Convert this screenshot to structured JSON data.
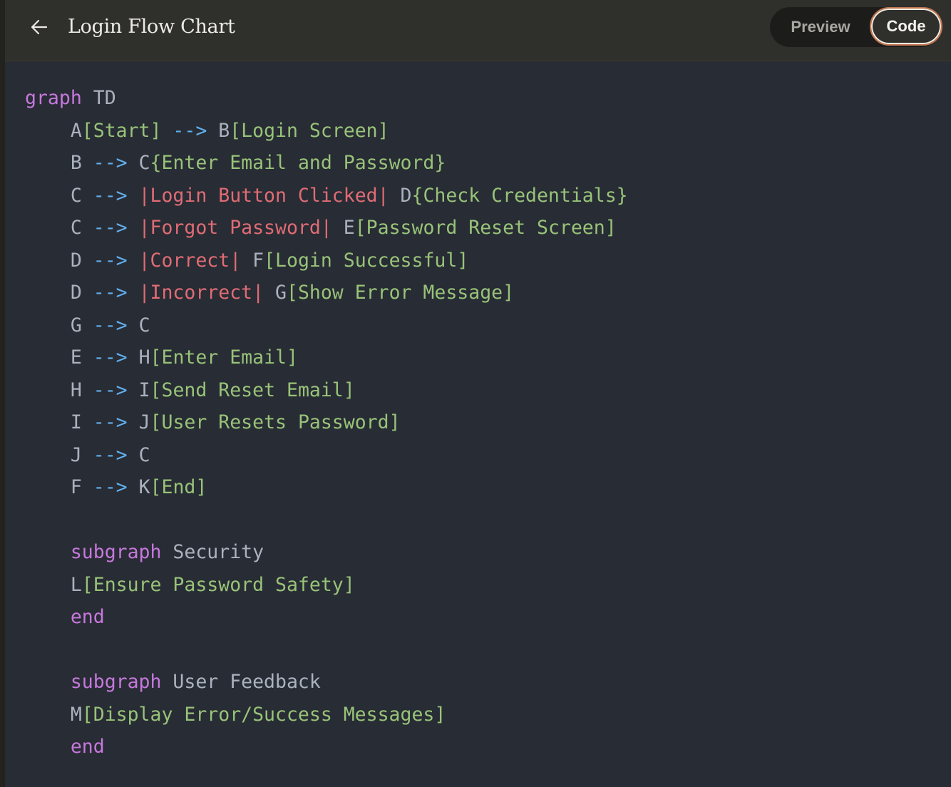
{
  "header": {
    "back_icon": "arrow-left-icon",
    "title": "Login Flow Chart",
    "toggle": {
      "preview_label": "Preview",
      "code_label": "Code",
      "active": "Code"
    }
  },
  "colors": {
    "keyword": "#c678dd",
    "identifier": "#abb2bf",
    "arrow": "#61afef",
    "node_text": "#98c379",
    "edge_label": "#e06c75",
    "code_background": "#282c34",
    "active_toggle_border": "#c27552"
  },
  "code": {
    "lines": [
      [
        {
          "t": "graph",
          "c": "kw"
        },
        {
          "t": " TD",
          "c": "plain"
        }
      ],
      [
        {
          "t": "    A",
          "c": "id"
        },
        {
          "t": "[Start]",
          "c": "node"
        },
        {
          "t": " --> ",
          "c": "arrow"
        },
        {
          "t": "B",
          "c": "id"
        },
        {
          "t": "[Login Screen]",
          "c": "node"
        }
      ],
      [
        {
          "t": "    B",
          "c": "id"
        },
        {
          "t": " --> ",
          "c": "arrow"
        },
        {
          "t": "C",
          "c": "id"
        },
        {
          "t": "{Enter Email and Password}",
          "c": "node"
        }
      ],
      [
        {
          "t": "    C",
          "c": "id"
        },
        {
          "t": " --> ",
          "c": "arrow"
        },
        {
          "t": "|Login Button Clicked|",
          "c": "edge"
        },
        {
          "t": " D",
          "c": "id"
        },
        {
          "t": "{Check Credentials}",
          "c": "node"
        }
      ],
      [
        {
          "t": "    C",
          "c": "id"
        },
        {
          "t": " --> ",
          "c": "arrow"
        },
        {
          "t": "|Forgot Password|",
          "c": "edge"
        },
        {
          "t": " E",
          "c": "id"
        },
        {
          "t": "[Password Reset Screen]",
          "c": "node"
        }
      ],
      [
        {
          "t": "    D",
          "c": "id"
        },
        {
          "t": " --> ",
          "c": "arrow"
        },
        {
          "t": "|Correct|",
          "c": "edge"
        },
        {
          "t": " F",
          "c": "id"
        },
        {
          "t": "[Login Successful]",
          "c": "node"
        }
      ],
      [
        {
          "t": "    D",
          "c": "id"
        },
        {
          "t": " --> ",
          "c": "arrow"
        },
        {
          "t": "|Incorrect|",
          "c": "edge"
        },
        {
          "t": " G",
          "c": "id"
        },
        {
          "t": "[Show Error Message]",
          "c": "node"
        }
      ],
      [
        {
          "t": "    G",
          "c": "id"
        },
        {
          "t": " --> ",
          "c": "arrow"
        },
        {
          "t": "C",
          "c": "id"
        }
      ],
      [
        {
          "t": "    E",
          "c": "id"
        },
        {
          "t": " --> ",
          "c": "arrow"
        },
        {
          "t": "H",
          "c": "id"
        },
        {
          "t": "[Enter Email]",
          "c": "node"
        }
      ],
      [
        {
          "t": "    H",
          "c": "id"
        },
        {
          "t": " --> ",
          "c": "arrow"
        },
        {
          "t": "I",
          "c": "id"
        },
        {
          "t": "[Send Reset Email]",
          "c": "node"
        }
      ],
      [
        {
          "t": "    I",
          "c": "id"
        },
        {
          "t": " --> ",
          "c": "arrow"
        },
        {
          "t": "J",
          "c": "id"
        },
        {
          "t": "[User Resets Password]",
          "c": "node"
        }
      ],
      [
        {
          "t": "    J",
          "c": "id"
        },
        {
          "t": " --> ",
          "c": "arrow"
        },
        {
          "t": "C",
          "c": "id"
        }
      ],
      [
        {
          "t": "    F",
          "c": "id"
        },
        {
          "t": " --> ",
          "c": "arrow"
        },
        {
          "t": "K",
          "c": "id"
        },
        {
          "t": "[End]",
          "c": "node"
        }
      ],
      [],
      [
        {
          "t": "    ",
          "c": "plain"
        },
        {
          "t": "subgraph",
          "c": "kw"
        },
        {
          "t": " Security",
          "c": "plain"
        }
      ],
      [
        {
          "t": "    L",
          "c": "id"
        },
        {
          "t": "[Ensure Password Safety]",
          "c": "node"
        }
      ],
      [
        {
          "t": "    ",
          "c": "plain"
        },
        {
          "t": "end",
          "c": "kw"
        }
      ],
      [],
      [
        {
          "t": "    ",
          "c": "plain"
        },
        {
          "t": "subgraph",
          "c": "kw"
        },
        {
          "t": " User Feedback",
          "c": "plain"
        }
      ],
      [
        {
          "t": "    M",
          "c": "id"
        },
        {
          "t": "[Display Error/Success Messages]",
          "c": "node"
        }
      ],
      [
        {
          "t": "    ",
          "c": "plain"
        },
        {
          "t": "end",
          "c": "kw"
        }
      ]
    ]
  }
}
